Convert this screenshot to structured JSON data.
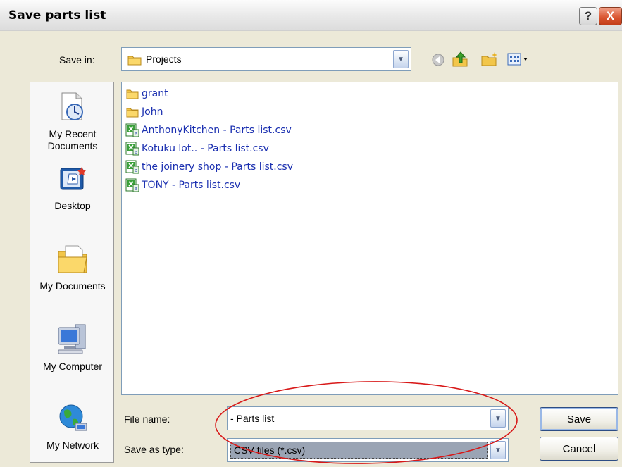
{
  "window": {
    "title": "Save parts list",
    "help_glyph": "?",
    "close_glyph": "X"
  },
  "save_in": {
    "label": "Save in:",
    "value": "Projects",
    "toolbar_icons": [
      "back-icon",
      "up-folder-icon",
      "new-folder-icon",
      "views-menu-icon"
    ]
  },
  "places": [
    {
      "label": "My Recent\nDocuments",
      "icon": "recent-documents-icon"
    },
    {
      "label": "Desktop",
      "icon": "desktop-icon"
    },
    {
      "label": "My Documents",
      "icon": "my-documents-icon"
    },
    {
      "label": "My Computer",
      "icon": "my-computer-icon"
    },
    {
      "label": "My Network",
      "icon": "my-network-icon"
    }
  ],
  "files": [
    {
      "name": "grant",
      "type": "folder"
    },
    {
      "name": "John",
      "type": "folder"
    },
    {
      "name": "AnthonyKitchen - Parts list.csv",
      "type": "csv"
    },
    {
      "name": "Kotuku lot.. - Parts list.csv",
      "type": "csv"
    },
    {
      "name": "the joinery shop - Parts list.csv",
      "type": "csv"
    },
    {
      "name": "TONY - Parts list.csv",
      "type": "csv"
    }
  ],
  "file_name": {
    "label": "File name:",
    "value": "- Parts list"
  },
  "save_as_type": {
    "label": "Save as type:",
    "value": "CSV files (*.csv)"
  },
  "buttons": {
    "save": "Save",
    "cancel": "Cancel"
  },
  "colors": {
    "annotation": "#d81818",
    "file_text": "#1a2fb0"
  }
}
